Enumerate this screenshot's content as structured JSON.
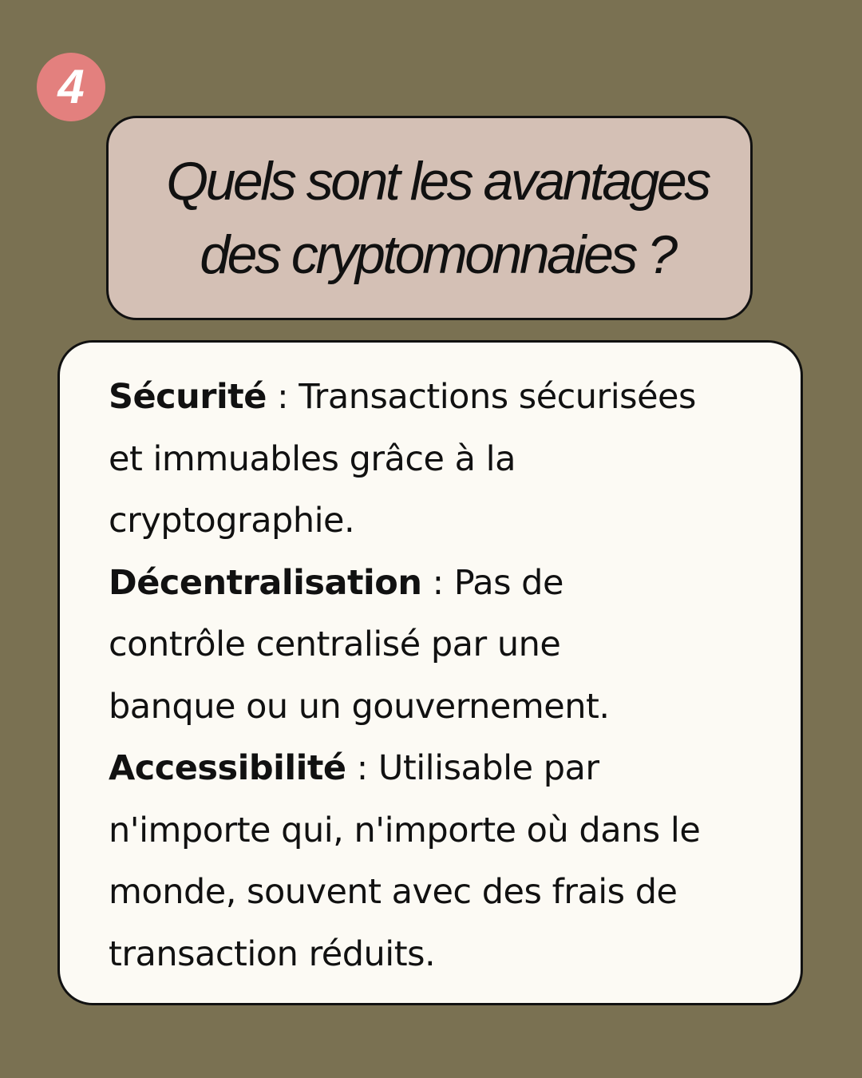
{
  "badge": {
    "number": "4"
  },
  "question": {
    "line1": "Quels sont les avantages",
    "line2": "des cryptomonnaies ?"
  },
  "advantages": [
    {
      "term": "Sécurité",
      "line1": " : Transactions sécurisées",
      "line2": "et immuables grâce à la",
      "line3": "cryptographie."
    },
    {
      "term": "Décentralisation",
      "line1": " : Pas de",
      "line2": "contrôle centralisé par une",
      "line3": "banque ou un gouvernement."
    },
    {
      "term": "Accessibilité",
      "line1": " : Utilisable par",
      "line2": "n'importe qui, n'importe où dans le",
      "line3": "monde, souvent avec des frais de",
      "line4": "transaction réduits."
    }
  ],
  "colors": {
    "background": "#7a7152",
    "badge": "#e3807e",
    "question_box": "#d4c0b5",
    "answer_card": "#fcfaf4"
  }
}
